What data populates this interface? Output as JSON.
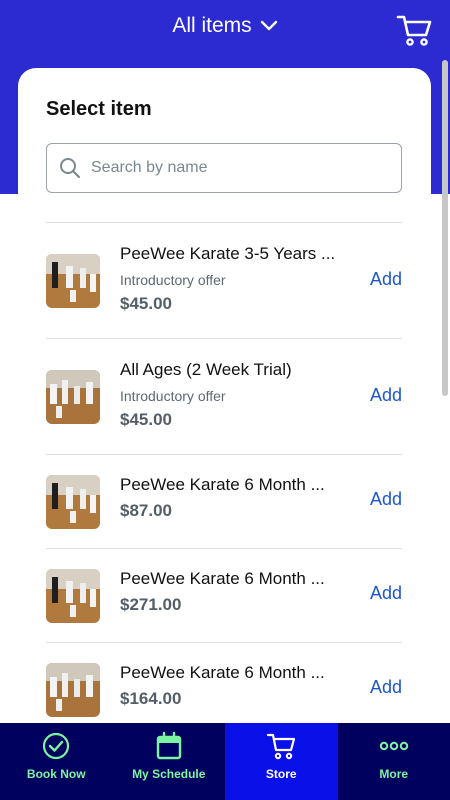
{
  "header": {
    "title": "All items",
    "dropdown_icon": "chevron-down-icon",
    "cart_icon": "cart-icon"
  },
  "card": {
    "title": "Select item",
    "search_placeholder": "Search by name"
  },
  "items": [
    {
      "name": "PeeWee Karate 3-5 Years ...",
      "subtitle": "Introductory offer",
      "price": "$45.00",
      "action": "Add"
    },
    {
      "name": "All Ages (2 Week Trial)",
      "subtitle": "Introductory offer",
      "price": "$45.00",
      "action": "Add"
    },
    {
      "name": "PeeWee Karate 6 Month ...",
      "price": "$87.00",
      "action": "Add"
    },
    {
      "name": "PeeWee Karate 6 Month ...",
      "price": "$271.00",
      "action": "Add"
    },
    {
      "name": "PeeWee Karate 6 Month ...",
      "price": "$164.00",
      "action": "Add"
    }
  ],
  "nav": [
    {
      "label": "Book Now",
      "icon": "check-circle-icon"
    },
    {
      "label": "My Schedule",
      "icon": "calendar-icon"
    },
    {
      "label": "Store",
      "icon": "cart-icon",
      "active": true
    },
    {
      "label": "More",
      "icon": "more-dots-icon"
    }
  ],
  "colors": {
    "header_bg": "#2b2bd1",
    "nav_bg": "#00005e",
    "nav_active_bg": "#0a10e8",
    "nav_text": "#7cf5a1",
    "link": "#1d57c8"
  }
}
